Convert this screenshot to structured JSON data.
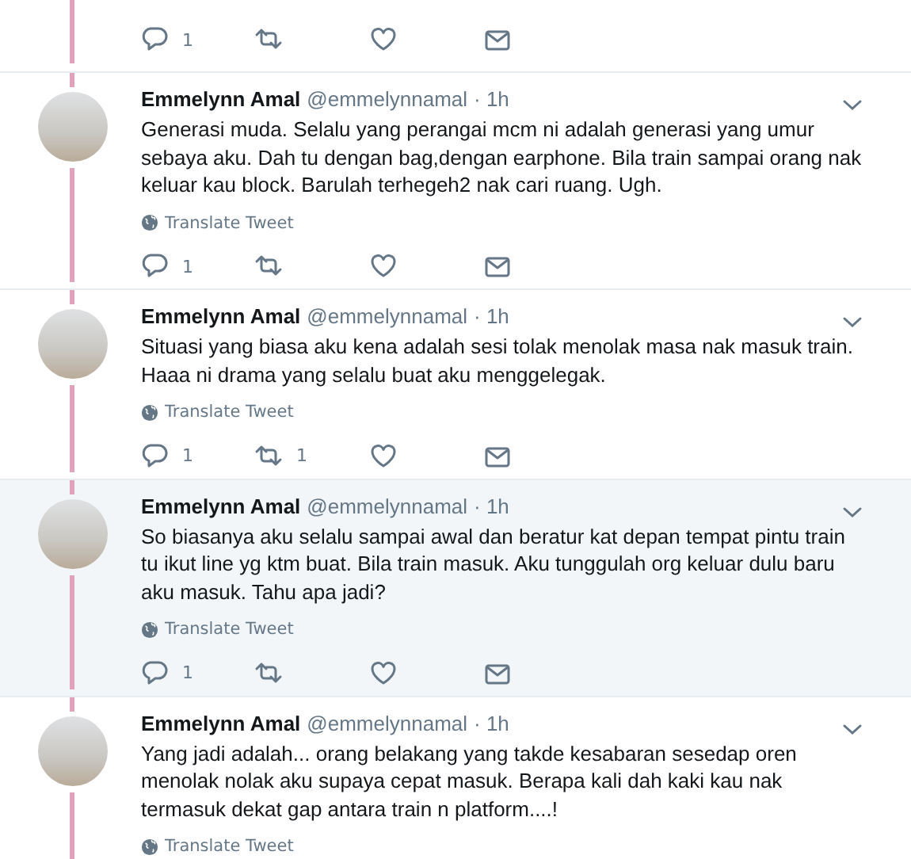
{
  "top_actions": {
    "reply_count": "1"
  },
  "tweets": [
    {
      "name": "Emmelynn Amal",
      "handle": "@emmelynnamal",
      "time": "· 1h",
      "text": "Generasi muda. Selalu yang perangai mcm ni adalah generasi yang umur sebaya aku. Dah tu dengan bag,dengan earphone. Bila train sampai orang nak keluar kau block. Barulah terhegeh2 nak cari ruang. Ugh.",
      "translate": "Translate Tweet",
      "reply_count": "1",
      "highlighted": false
    },
    {
      "name": "Emmelynn Amal",
      "handle": "@emmelynnamal",
      "time": "· 1h",
      "text": "Situasi yang biasa aku kena adalah sesi tolak menolak masa nak masuk train. Haaa ni drama yang selalu buat aku menggelegak.",
      "translate": "Translate Tweet",
      "reply_count": "1",
      "retweet_count": "1",
      "highlighted": false
    },
    {
      "name": "Emmelynn Amal",
      "handle": "@emmelynnamal",
      "time": "· 1h",
      "text": "So biasanya aku selalu sampai awal dan beratur kat depan tempat pintu train tu ikut line yg ktm buat. Bila train masuk. Aku tunggulah org keluar dulu baru aku masuk. Tahu apa jadi?",
      "translate": "Translate Tweet",
      "reply_count": "1",
      "highlighted": true
    },
    {
      "name": "Emmelynn Amal",
      "handle": "@emmelynnamal",
      "time": "· 1h",
      "text": "Yang jadi adalah... orang belakang yang takde kesabaran sesedap oren menolak nolak aku supaya cepat masuk. Berapa kali dah kaki kau nak termasuk dekat gap antara train n platform....!",
      "translate": "Translate Tweet",
      "highlighted": false
    }
  ]
}
